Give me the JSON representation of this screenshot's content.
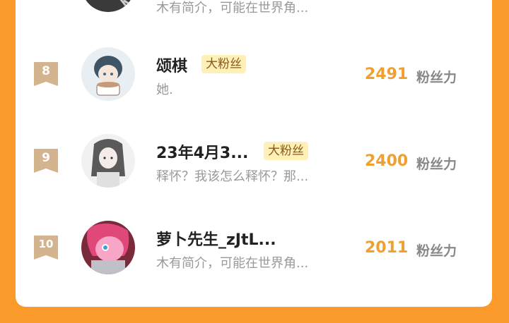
{
  "fan_ranking": {
    "partial_top_row": {
      "bio": "木有简介，可能在世界角..."
    },
    "rows": [
      {
        "rank": "8",
        "name": "颂棋",
        "badge": "大粉丝",
        "bio": "她.",
        "score": "2491",
        "unit": "粉丝力"
      },
      {
        "rank": "9",
        "name": "23年4月3...",
        "badge": "大粉丝",
        "bio": "释怀？我该怎么释怀？那...",
        "score": "2400",
        "unit": "粉丝力"
      },
      {
        "rank": "10",
        "name": "萝卜先生_zJtL...",
        "badge": "",
        "bio": "木有简介，可能在世界角...",
        "score": "2011",
        "unit": "粉丝力"
      }
    ]
  },
  "colors": {
    "background": "#fa9a2a",
    "score": "#f0a030",
    "badge_bg": "#fff0b8",
    "rank_bg": "#d4b48e"
  }
}
